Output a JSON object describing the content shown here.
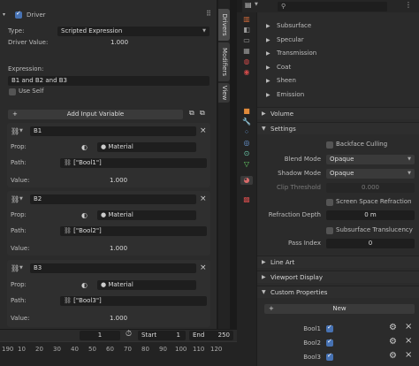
{
  "driver": {
    "header_label": "Driver",
    "type_label": "Type:",
    "type_value": "Scripted Expression",
    "driver_value_label": "Driver Value:",
    "driver_value": "1.000",
    "expression_label": "Expression:",
    "expression_value": "B1 and B2 and B3",
    "use_self_label": "Use Self",
    "add_input_variable": "Add Input Variable",
    "prop_label": "Prop:",
    "path_label": "Path:",
    "value_label": "Value:",
    "material_label": "Material",
    "variables": [
      {
        "name": "B1",
        "path": "[\"Bool1\"]",
        "value": "1.000"
      },
      {
        "name": "B2",
        "path": "[\"Bool2\"]",
        "value": "1.000"
      },
      {
        "name": "B3",
        "path": "[\"Bool3\"]",
        "value": "1.000"
      }
    ]
  },
  "side_tabs": [
    "Drivers",
    "Modifiers",
    "View"
  ],
  "properties": {
    "search_placeholder": "",
    "surface_items": [
      "Subsurface",
      "Specular",
      "Transmission",
      "Coat",
      "Sheen",
      "Emission"
    ],
    "sections": {
      "volume": "Volume",
      "settings": "Settings",
      "line_art": "Line Art",
      "viewport_display": "Viewport Display",
      "custom_properties": "Custom Properties"
    },
    "backface_culling": "Backface Culling",
    "blend_mode_label": "Blend Mode",
    "blend_mode_value": "Opaque",
    "shadow_mode_label": "Shadow Mode",
    "shadow_mode_value": "Opaque",
    "clip_threshold_label": "Clip Threshold",
    "clip_threshold_value": "0.000",
    "screen_space_refraction": "Screen Space Refraction",
    "refraction_depth_label": "Refraction Depth",
    "refraction_depth_value": "0 m",
    "subsurface_translucency": "Subsurface Translucency",
    "pass_index_label": "Pass Index",
    "pass_index_value": "0",
    "new_button": "New",
    "custom_props": [
      "Bool1",
      "Bool2",
      "Bool3"
    ]
  },
  "timeline": {
    "current_frame": "1",
    "start_label": "Start",
    "start_value": "1",
    "end_label": "End",
    "end_value": "250",
    "ticks": [
      "190",
      "10",
      "20",
      "30",
      "40",
      "50",
      "60",
      "70",
      "80",
      "90",
      "100",
      "110",
      "120"
    ]
  },
  "colors": {
    "accent": "#4772b3",
    "panel": "#2b2b2b",
    "field": "#1e1e1e"
  }
}
